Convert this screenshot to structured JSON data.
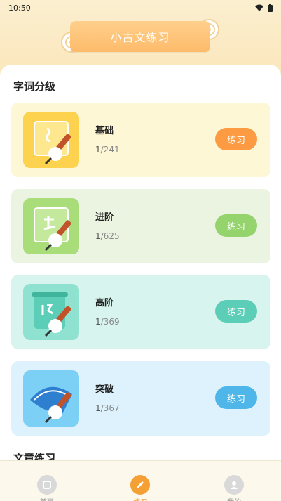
{
  "status": {
    "time": "10:50"
  },
  "header": {
    "title": "小古文练习"
  },
  "sections": [
    {
      "title": "字词分级"
    },
    {
      "title": "文章练习"
    }
  ],
  "levels": [
    {
      "name": "基础",
      "current": "1",
      "total": "/241",
      "button": "练习",
      "bg": "#fdf7d6",
      "btn_color": "#fd9b42",
      "icon_bg": "#fcd24e"
    },
    {
      "name": "进阶",
      "current": "1",
      "total": "/625",
      "button": "练习",
      "bg": "#eaf4e0",
      "btn_color": "#95d36c",
      "icon_bg": "#a9dd7a"
    },
    {
      "name": "高阶",
      "current": "1",
      "total": "/369",
      "button": "练习",
      "bg": "#d8f4ee",
      "btn_color": "#5ccdb6",
      "icon_bg": "#8ee2cf"
    },
    {
      "name": "突破",
      "current": "1",
      "total": "/367",
      "button": "练习",
      "bg": "#ddf2fd",
      "btn_color": "#4fb6ea",
      "icon_bg": "#7dd0f5"
    }
  ],
  "tabs": [
    {
      "label": "首页",
      "icon": "home-icon"
    },
    {
      "label": "练习",
      "icon": "brush-icon"
    },
    {
      "label": "我的",
      "icon": "profile-icon"
    }
  ],
  "colors": {
    "accent": "#f4a035",
    "banner": "#fdbb6a"
  }
}
